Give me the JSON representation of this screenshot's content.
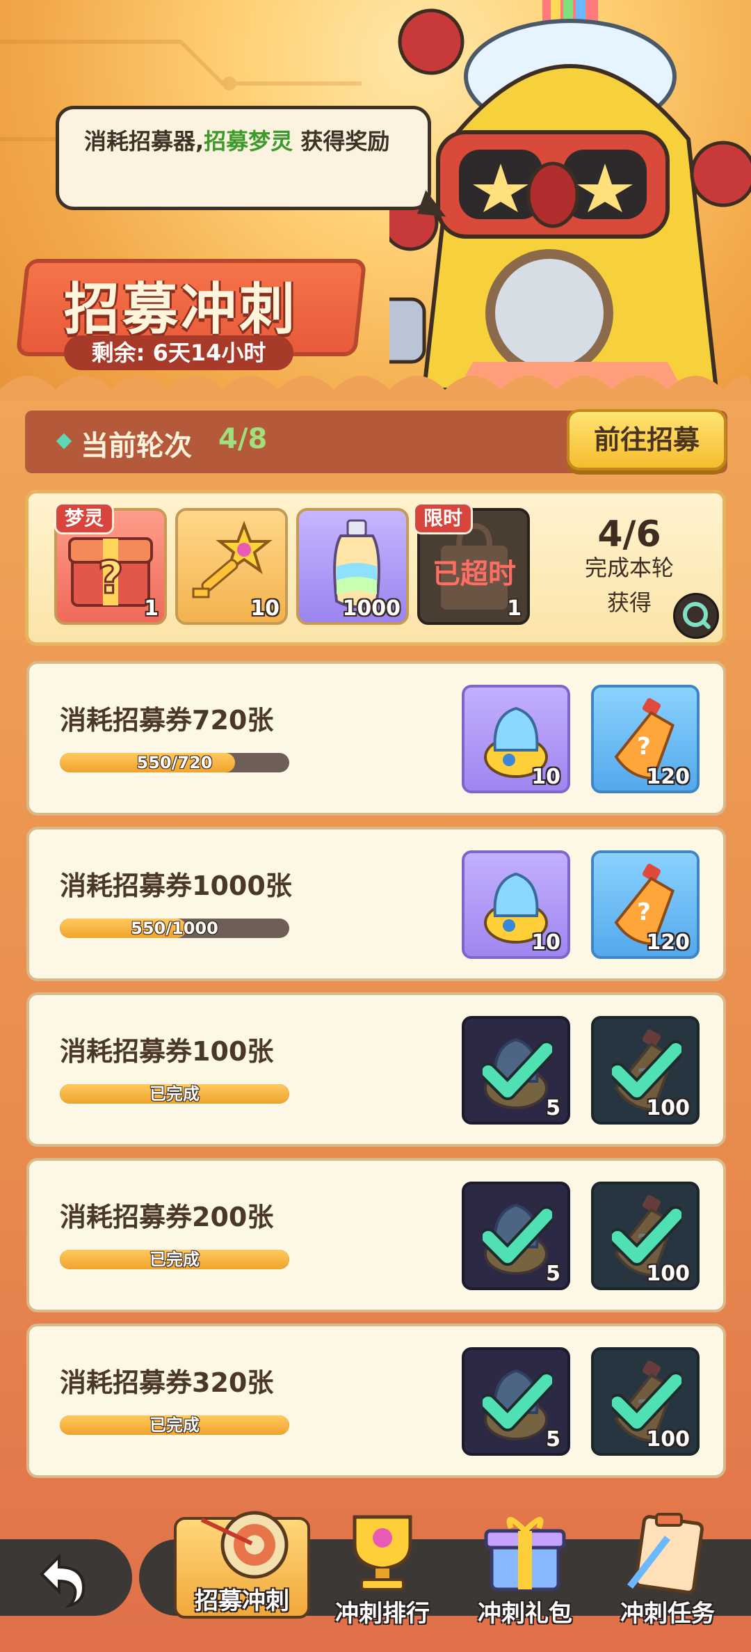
{
  "hero": {
    "bubble_text_a": "消耗招募器,",
    "bubble_text_hl": "招募梦灵",
    "bubble_text_b": " 获得奖励",
    "title": "招募冲刺",
    "remaining": "剩余: 6天14小时"
  },
  "round": {
    "label": "当前轮次",
    "value": "4/8",
    "goto_button": "前往招募"
  },
  "round_rewards": {
    "items": [
      {
        "tag": "梦灵",
        "icon": "mystery-chest-icon",
        "qty": "1"
      },
      {
        "icon": "star-key-icon",
        "qty": "10"
      },
      {
        "icon": "rainbow-bottle-icon",
        "qty": "1000"
      },
      {
        "tag": "限时",
        "icon": "gift-bag-icon",
        "overlay": "已超时",
        "qty": "1"
      }
    ],
    "progress": "4/6",
    "line1": "完成本轮",
    "line2": "获得"
  },
  "tasks": [
    {
      "title": "消耗招募券720张",
      "progress_text": "550/720",
      "progress": 0.764,
      "done": false,
      "rewards": [
        {
          "icon": "spirit-egg-icon",
          "qty": "10"
        },
        {
          "icon": "mystery-potion-icon",
          "qty": "120"
        }
      ]
    },
    {
      "title": "消耗招募券1000张",
      "progress_text": "550/1000",
      "progress": 0.55,
      "done": false,
      "rewards": [
        {
          "icon": "spirit-egg-icon",
          "qty": "10"
        },
        {
          "icon": "mystery-potion-icon",
          "qty": "120"
        }
      ]
    },
    {
      "title": "消耗招募券100张",
      "progress_text": "已完成",
      "progress": 1,
      "done": true,
      "rewards": [
        {
          "icon": "spirit-egg-icon",
          "qty": "5"
        },
        {
          "icon": "mystery-potion-icon",
          "qty": "100"
        }
      ]
    },
    {
      "title": "消耗招募券200张",
      "progress_text": "已完成",
      "progress": 1,
      "done": true,
      "rewards": [
        {
          "icon": "spirit-egg-icon",
          "qty": "5"
        },
        {
          "icon": "mystery-potion-icon",
          "qty": "100"
        }
      ]
    },
    {
      "title": "消耗招募券320张",
      "progress_text": "已完成",
      "progress": 1,
      "done": true,
      "rewards": [
        {
          "icon": "spirit-egg-icon",
          "qty": "5"
        },
        {
          "icon": "mystery-potion-icon",
          "qty": "100"
        }
      ]
    }
  ],
  "nav": {
    "back": "back-arrow-icon",
    "tabs": [
      {
        "label": "招募冲刺",
        "icon": "dartboard-icon",
        "active": true
      },
      {
        "label": "冲刺排行",
        "icon": "trophy-icon",
        "active": false
      },
      {
        "label": "冲刺礼包",
        "icon": "gift-box-icon",
        "active": false
      },
      {
        "label": "冲刺任务",
        "icon": "clipboard-icon",
        "active": false
      }
    ]
  },
  "colors": {
    "accent": "#f6bd2d",
    "green": "#3c9a2b",
    "check": "#4fe0b4"
  }
}
